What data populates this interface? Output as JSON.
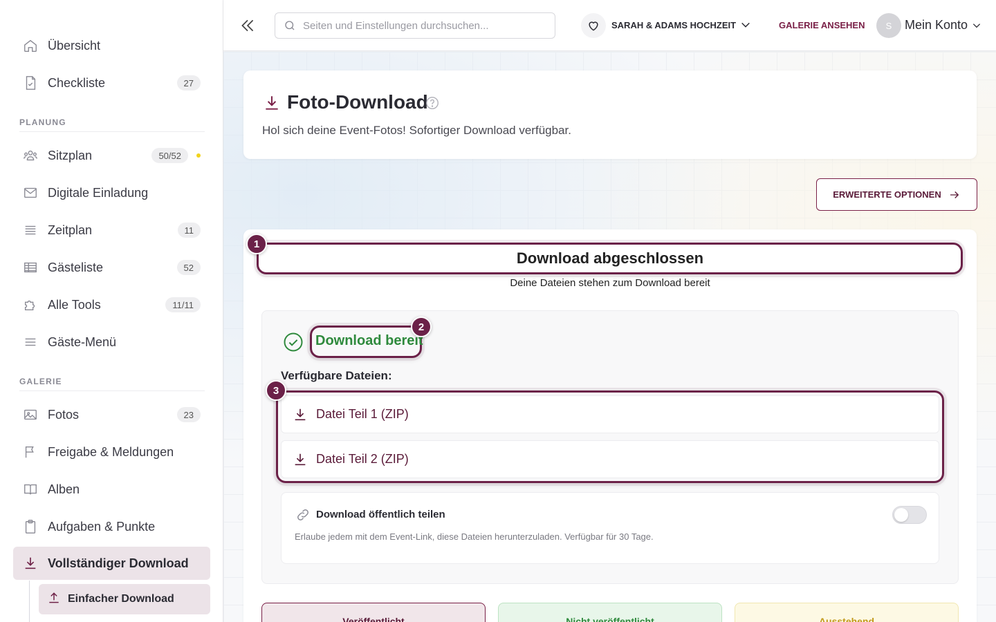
{
  "sidebar": {
    "items": [
      {
        "label": "Übersicht",
        "icon": "home-icon"
      },
      {
        "label": "Checkliste",
        "badge": "27",
        "icon": "checklist-icon"
      },
      {
        "label": "Sitzplan",
        "badge": "50/52",
        "icon": "users-icon"
      },
      {
        "label": "Digitale Einladung",
        "icon": "mail-icon"
      },
      {
        "label": "Zeitplan",
        "badge": "11",
        "icon": "timeline-icon"
      },
      {
        "label": "Gästeliste",
        "badge": "52",
        "icon": "table-icon"
      },
      {
        "label": "Alle Tools",
        "badge": "11/11",
        "icon": "puzzle-icon"
      },
      {
        "label": "Gäste-Menü",
        "icon": "menu-icon"
      },
      {
        "label": "Fotos",
        "badge": "23",
        "icon": "image-icon"
      },
      {
        "label": "Freigabe & Meldungen",
        "icon": "flag-icon"
      },
      {
        "label": "Alben",
        "icon": "book-icon"
      },
      {
        "label": "Aufgaben & Punkte",
        "icon": "clipboard-icon"
      },
      {
        "label": "Vollständiger Download",
        "icon": "download-icon",
        "active": true
      }
    ],
    "sections": {
      "planning": "PLANUNG",
      "gallery": "GALERIE"
    },
    "sub_item": {
      "label": "Einfacher Download",
      "icon": "upload-icon"
    },
    "status_dot_color": "#f2d31b"
  },
  "topbar": {
    "search_placeholder": "Seiten und Einstellungen durchsuchen...",
    "event_name": "SARAH & ADAMS HOCHZEIT",
    "gallery_link": "GALERIE ANSEHEN",
    "avatar_initial": "S",
    "account_label": "Mein Konto"
  },
  "page": {
    "title": "Foto-Download",
    "subtitle": "Hol sich deine Event-Fotos! Sofortiger Download verfügbar.",
    "advanced_button": "ERWEITERTE OPTIONEN"
  },
  "download": {
    "status_title": "Download abgeschlossen",
    "status_subtitle": "Deine Dateien stehen zum Download bereit",
    "ready_label": "Download bereit",
    "files_title": "Verfügbare Dateien:",
    "files": [
      "Datei Teil 1 (ZIP)",
      "Datei Teil 2 (ZIP)"
    ],
    "share_title": "Download öffentlich teilen",
    "share_desc": "Erlaube jedem mit dem Event-Link, diese Dateien herunterzuladen. Verfügbar für 30 Tage.",
    "share_enabled": false
  },
  "steps": [
    "1",
    "2",
    "3"
  ],
  "tabs": [
    "Veröffentlicht",
    "Nicht veröffentlicht",
    "Ausstehend"
  ],
  "colors": {
    "accent": "#7a2047",
    "success": "#2f8a3d",
    "warning": "#c29a1a"
  }
}
